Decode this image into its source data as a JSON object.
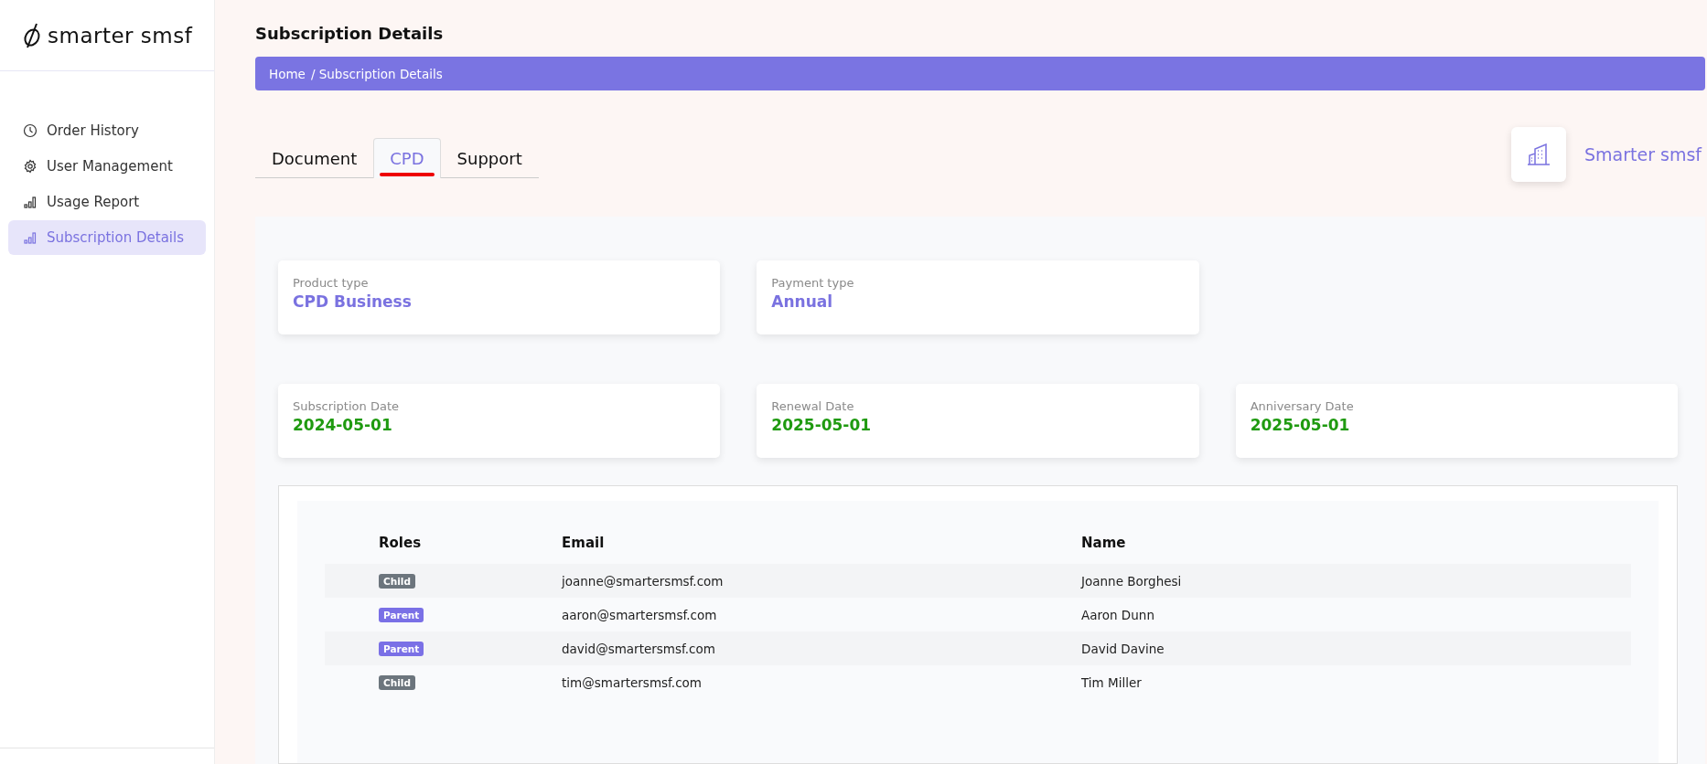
{
  "sidebar": {
    "logo": "smarter smsf",
    "items": [
      {
        "label": "Order History",
        "selected": false
      },
      {
        "label": "User Management",
        "selected": false
      },
      {
        "label": "Usage Report",
        "selected": false
      },
      {
        "label": "Subscription Details",
        "selected": true
      }
    ]
  },
  "page_title": "Subscription Details",
  "breadcrumb": [
    "Home",
    "/ Subscription Details"
  ],
  "tabs": [
    {
      "label": "Document",
      "selected": false
    },
    {
      "label": "CPD",
      "selected": true
    },
    {
      "label": "Support",
      "selected": false
    }
  ],
  "company": {
    "name": "Smarter smsf"
  },
  "plan_cards": [
    {
      "label": "Product type",
      "value": "CPD Business"
    },
    {
      "label": "Payment type",
      "value": "Annual"
    }
  ],
  "date_cards": [
    {
      "label": "Subscription Date",
      "value": "2024-05-01"
    },
    {
      "label": "Renewal Date",
      "value": "2025-05-01"
    },
    {
      "label": "Anniversary Date",
      "value": "2025-05-01"
    }
  ],
  "table": {
    "columns": [
      "Roles",
      "Email",
      "Name"
    ],
    "rows": [
      {
        "role": {
          "label": "Child",
          "kind": "child"
        },
        "email": "joanne@smartersmsf.com",
        "name": "Joanne Borghesi"
      },
      {
        "role": {
          "label": "Parent",
          "kind": "parent"
        },
        "email": "aaron@smartersmsf.com",
        "name": "Aaron Dunn"
      },
      {
        "role": {
          "label": "Parent",
          "kind": "parent"
        },
        "email": "david@smartersmsf.com",
        "name": "David Davine"
      },
      {
        "role": {
          "label": "Child",
          "kind": "child"
        },
        "email": "tim@smartersmsf.com",
        "name": "Tim Miller"
      }
    ]
  }
}
